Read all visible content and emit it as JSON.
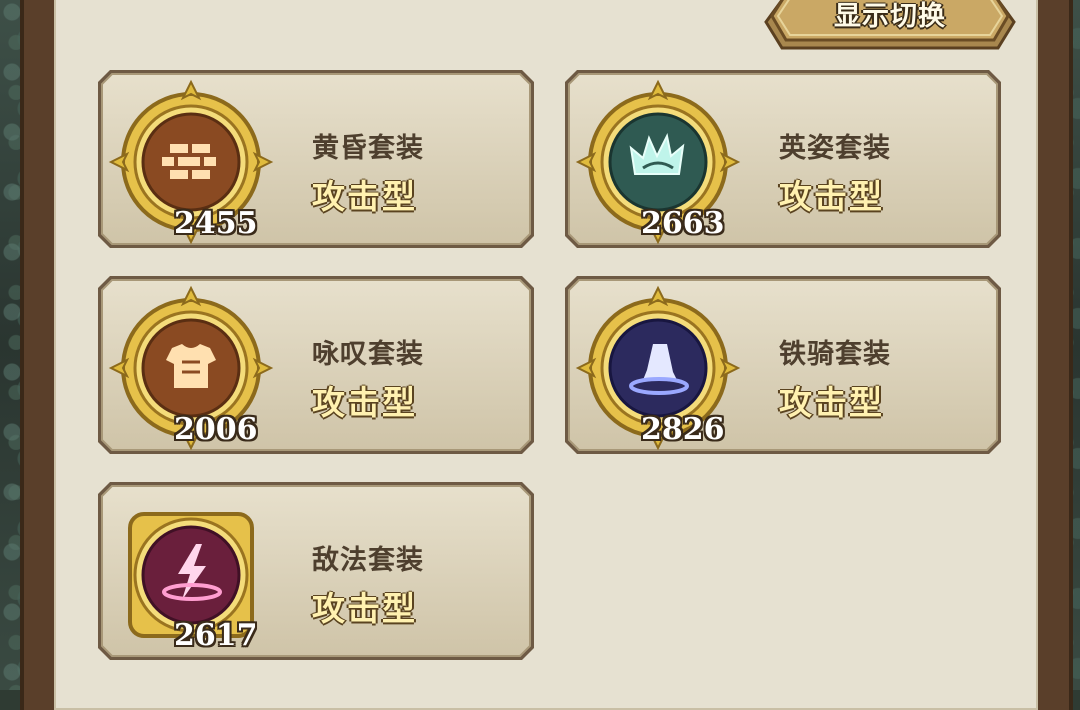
{
  "header": {
    "toggle_label": "显示切换"
  },
  "sets": [
    {
      "name": "黄昏套装",
      "type": "攻击型",
      "score": "2455",
      "icon": "brick-wall-icon",
      "color": "#8a4a22"
    },
    {
      "name": "英姿套装",
      "type": "攻击型",
      "score": "2663",
      "icon": "crown-splash-icon",
      "color": "#2f5a52"
    },
    {
      "name": "咏叹套装",
      "type": "攻击型",
      "score": "2006",
      "icon": "armor-icon",
      "color": "#8a4a22"
    },
    {
      "name": "铁骑套装",
      "type": "攻击型",
      "score": "2826",
      "icon": "horse-hoof-icon",
      "color": "#2c2a5e"
    },
    {
      "name": "敌法套装",
      "type": "攻击型",
      "score": "2617",
      "icon": "lightning-icon",
      "color": "#6a1f3c"
    }
  ]
}
